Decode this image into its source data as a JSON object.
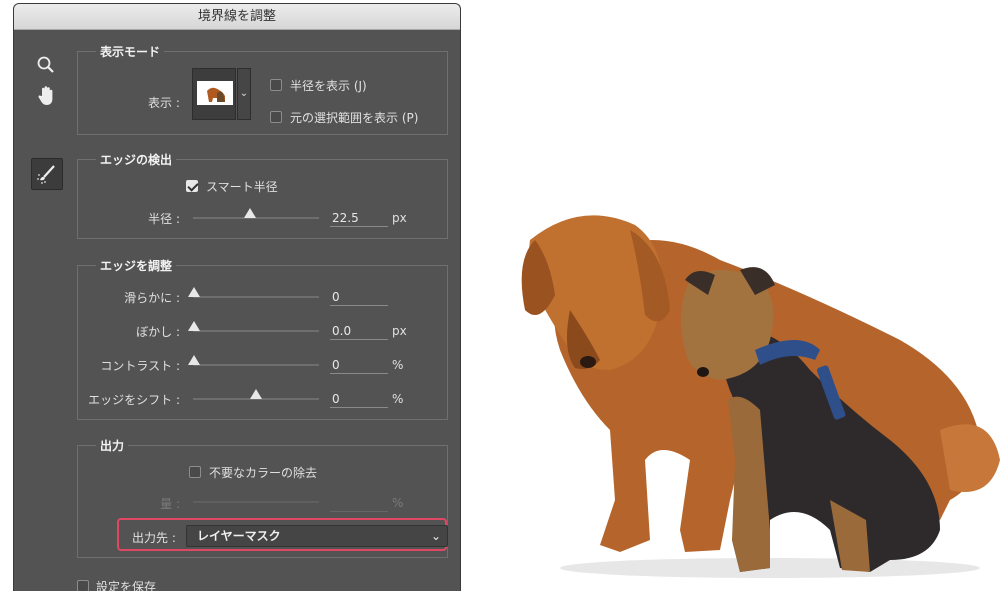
{
  "dialog": {
    "title": "境界線を調整"
  },
  "tools": [
    "zoom-icon",
    "hand-icon",
    "refine-radius-brush-icon"
  ],
  "view_mode": {
    "title": "表示モード",
    "view_label": "表示 :",
    "show_radius": {
      "label": "半径を表示 (J)",
      "checked": false
    },
    "show_original": {
      "label": "元の選択範囲を表示 (P)",
      "checked": false
    }
  },
  "edge_detection": {
    "title": "エッジの検出",
    "smart_radius": {
      "label": "スマート半径",
      "checked": true
    },
    "radius_label": "半径 :",
    "radius_value": "22.5",
    "radius_unit": "px",
    "radius_level": 0.45
  },
  "adjust_edge": {
    "title": "エッジを調整",
    "rows": [
      {
        "label": "滑らかに :",
        "value": "0",
        "unit": "",
        "level": 0
      },
      {
        "label": "ぼかし :",
        "value": "0.0",
        "unit": "px",
        "level": 0
      },
      {
        "label": "コントラスト :",
        "value": "0",
        "unit": "%",
        "level": 0
      },
      {
        "label": "エッジをシフト :",
        "value": "0",
        "unit": "%",
        "level": 0.5
      }
    ]
  },
  "output": {
    "title": "出力",
    "decontaminate": {
      "label": "不要なカラーの除去",
      "checked": false
    },
    "amount_label": "量 :",
    "amount_unit": "%",
    "output_to_label": "出力先 :",
    "output_to_value": "レイヤーマスク"
  },
  "save_settings": {
    "label": "設定を保存",
    "checked": false
  },
  "colors": {
    "panel": "#535353",
    "highlight": "#e04763"
  }
}
